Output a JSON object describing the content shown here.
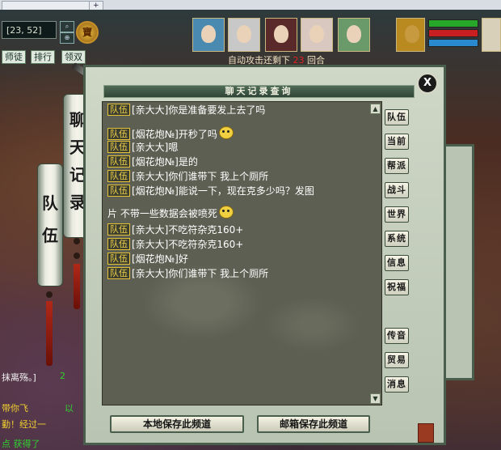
{
  "browser": {
    "tab_label": "+"
  },
  "hud": {
    "coords": "[23, 52]",
    "treasure_label": "寶",
    "top_buttons": [
      "师徒",
      "排行",
      "领双"
    ],
    "status": "自动攻击还剩下",
    "status_suffix": "回合",
    "bg_lines": [
      "抹离殇。]",
      "2",
      "带你飞",
      "以",
      "勤！经过一",
      "点 获得了"
    ]
  },
  "side_scrolls": {
    "tall_label": "聊天记录",
    "short_label": "队伍"
  },
  "panel": {
    "title": "聊天记录查询",
    "close_label": "X",
    "messages": [
      {
        "channel": "队伍",
        "text": "[亲大大]你是准备要发上去了吗",
        "emoji": false
      },
      {
        "channel": "队伍",
        "text": "[烟花炮№]开秒了吗",
        "emoji": true
      },
      {
        "channel": "队伍",
        "text": "[亲大大]嗯",
        "emoji": false
      },
      {
        "channel": "队伍",
        "text": "[烟花炮№]是的",
        "emoji": false
      },
      {
        "channel": "队伍",
        "text": "[亲大大]你们谁带下 我上个厕所",
        "emoji": false
      },
      {
        "channel": "队伍",
        "text": "[烟花炮№]能说一下，现在克多少吗？发图",
        "emoji": false
      },
      {
        "channel": "",
        "text": "片 不带一些数据会被喷死",
        "emoji": true
      },
      {
        "channel": "队伍",
        "text": "[亲大大]不吃符杂克160+",
        "emoji": false
      },
      {
        "channel": "队伍",
        "text": "[亲大大]不吃符杂克160+",
        "emoji": false
      },
      {
        "channel": "队伍",
        "text": "[烟花炮№]好",
        "emoji": false
      },
      {
        "channel": "队伍",
        "text": "[亲大大]你们谁带下 我上个厕所",
        "emoji": false
      }
    ],
    "channel_buttons": [
      "队伍",
      "当前",
      "帮派",
      "战斗",
      "世界",
      "系统",
      "信息",
      "祝福"
    ],
    "extra_buttons": [
      "传音",
      "贸易",
      "消息"
    ],
    "save_local_label": "本地保存此频道",
    "save_mail_label": "邮箱保存此频道"
  }
}
